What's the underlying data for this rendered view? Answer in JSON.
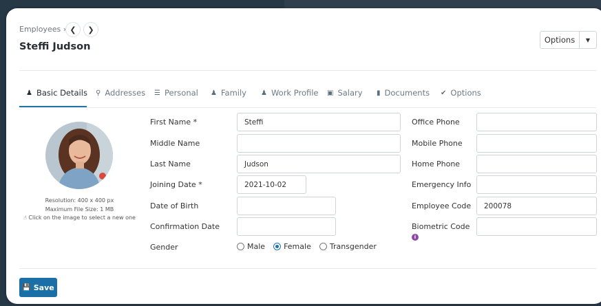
{
  "breadcrumb": {
    "label": "Employees »",
    "prev_icon": "chevron-left-icon",
    "next_icon": "chevron-right-icon"
  },
  "page": {
    "title": "Steffi Judson"
  },
  "options": {
    "label": "Options"
  },
  "tabs": [
    {
      "label": "Basic Details",
      "icon": "user-icon",
      "active": true
    },
    {
      "label": "Addresses",
      "icon": "map-pin-icon"
    },
    {
      "label": "Personal",
      "icon": "list-icon"
    },
    {
      "label": "Family",
      "icon": "users-icon"
    },
    {
      "label": "Work Profile",
      "icon": "briefcase-user-icon"
    },
    {
      "label": "Salary",
      "icon": "money-icon"
    },
    {
      "label": "Documents",
      "icon": "file-icon"
    },
    {
      "label": "Options",
      "icon": "check-circle-icon"
    }
  ],
  "avatar": {
    "resolution": "Resolution: 400 x 400 px",
    "max_size": "Maximum File Size: 1 MB",
    "hint": "Click on the image to select a new one"
  },
  "form": {
    "first_name": {
      "label": "First Name *",
      "value": "Steffi"
    },
    "middle_name": {
      "label": "Middle Name",
      "value": ""
    },
    "last_name": {
      "label": "Last Name",
      "value": "Judson"
    },
    "joining_date": {
      "label": "Joining Date *",
      "value": "2021-10-02"
    },
    "date_of_birth": {
      "label": "Date of Birth",
      "value": ""
    },
    "confirmation_date": {
      "label": "Confirmation Date",
      "value": ""
    },
    "gender": {
      "label": "Gender",
      "options": [
        "Male",
        "Female",
        "Transgender"
      ],
      "selected": "Female"
    },
    "office_phone": {
      "label": "Office Phone",
      "value": ""
    },
    "mobile_phone": {
      "label": "Mobile Phone",
      "value": ""
    },
    "home_phone": {
      "label": "Home Phone",
      "value": ""
    },
    "emergency_info": {
      "label": "Emergency Info",
      "value": ""
    },
    "employee_code": {
      "label": "Employee Code",
      "value": "200078"
    },
    "biometric_code": {
      "label": "Biometric Code",
      "value": ""
    }
  },
  "save": {
    "label": "Save"
  },
  "colors": {
    "primary": "#1a70a6",
    "background": "#263746",
    "info": "#8b4aa0"
  }
}
